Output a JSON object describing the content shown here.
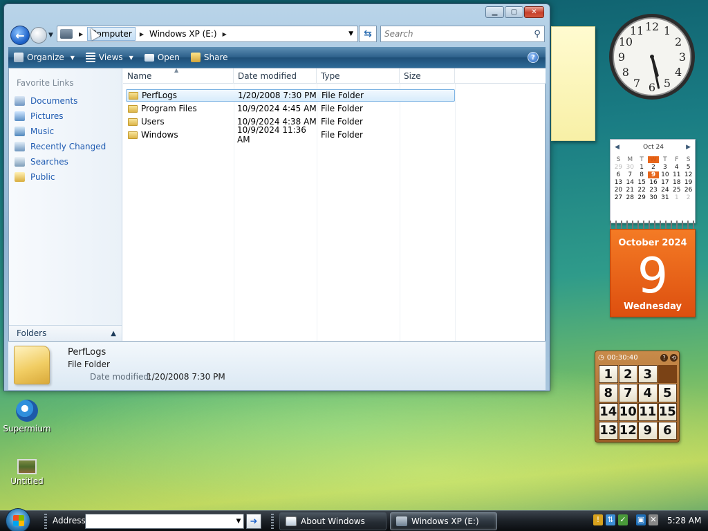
{
  "explorer": {
    "address": {
      "crumbs": [
        "Computer",
        "Windows XP (E:)"
      ]
    },
    "search": {
      "placeholder": "Search"
    },
    "toolbar": {
      "organize": "Organize",
      "views": "Views",
      "open": "Open",
      "share": "Share",
      "help": "?"
    },
    "nav_pane": {
      "header": "Favorite Links",
      "links": [
        "Documents",
        "Pictures",
        "Music",
        "Recently Changed",
        "Searches",
        "Public"
      ],
      "folders_label": "Folders"
    },
    "columns": [
      "Name",
      "Date modified",
      "Type",
      "Size"
    ],
    "files": [
      {
        "name": "PerfLogs",
        "date": "1/20/2008 7:30 PM",
        "type": "File Folder",
        "selected": true
      },
      {
        "name": "Program Files",
        "date": "10/9/2024 4:45 AM",
        "type": "File Folder"
      },
      {
        "name": "Users",
        "date": "10/9/2024 4:38 AM",
        "type": "File Folder"
      },
      {
        "name": "Windows",
        "date": "10/9/2024 11:36 AM",
        "type": "File Folder"
      }
    ],
    "details": {
      "name": "PerfLogs",
      "type": "File Folder",
      "date_label": "Date modified:",
      "date_value": "1/20/2008 7:30 PM"
    }
  },
  "clock_gadget": {
    "numbers": [
      "12",
      "1",
      "2",
      "3",
      "4",
      "5",
      "6",
      "7",
      "8",
      "9",
      "10",
      "11"
    ],
    "hour": 5,
    "minute": 28
  },
  "calendar_gadget": {
    "month_short": "Oct 24",
    "weekdays": [
      "S",
      "M",
      "T",
      "W",
      "T",
      "F",
      "S"
    ],
    "today_weekday_index": 3,
    "days": [
      {
        "d": "29",
        "m": true
      },
      {
        "d": "30",
        "m": true
      },
      {
        "d": "1"
      },
      {
        "d": "2"
      },
      {
        "d": "3"
      },
      {
        "d": "4"
      },
      {
        "d": "5"
      },
      {
        "d": "6"
      },
      {
        "d": "7"
      },
      {
        "d": "8"
      },
      {
        "d": "9",
        "t": true
      },
      {
        "d": "10"
      },
      {
        "d": "11"
      },
      {
        "d": "12"
      },
      {
        "d": "13"
      },
      {
        "d": "14"
      },
      {
        "d": "15"
      },
      {
        "d": "16"
      },
      {
        "d": "17"
      },
      {
        "d": "18"
      },
      {
        "d": "19"
      },
      {
        "d": "20"
      },
      {
        "d": "21"
      },
      {
        "d": "22"
      },
      {
        "d": "23"
      },
      {
        "d": "24"
      },
      {
        "d": "25"
      },
      {
        "d": "26"
      },
      {
        "d": "27"
      },
      {
        "d": "28"
      },
      {
        "d": "29"
      },
      {
        "d": "30"
      },
      {
        "d": "31"
      },
      {
        "d": "1",
        "m": true
      },
      {
        "d": "2",
        "m": true
      }
    ],
    "month_year": "October 2024",
    "day_number": "9",
    "weekday": "Wednesday"
  },
  "puzzle_gadget": {
    "timer": "00:30:40",
    "tiles": [
      "1",
      "2",
      "3",
      "",
      "8",
      "7",
      "4",
      "5",
      "14",
      "10",
      "11",
      "15",
      "13",
      "12",
      "9",
      "6"
    ]
  },
  "desktop_icons": [
    {
      "label": "Supermium"
    },
    {
      "label": "Untitled"
    }
  ],
  "taskbar": {
    "address_label": "Address",
    "address_value": "",
    "buttons": [
      {
        "label": "About Windows"
      },
      {
        "label": "Windows XP (E:)",
        "active": true
      }
    ],
    "time": "5:28 AM"
  }
}
